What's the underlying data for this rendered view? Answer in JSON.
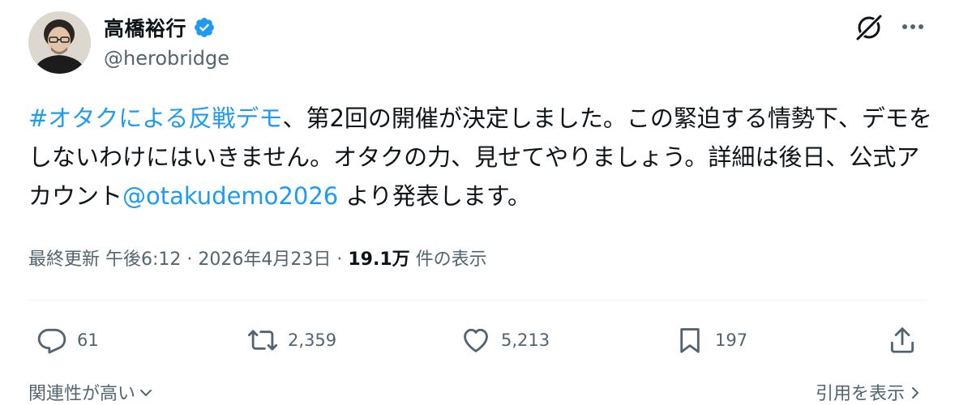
{
  "author": {
    "display_name": "高橋裕行",
    "handle": "@herobridge",
    "verified": true
  },
  "header_icons": {
    "grok": "grok-icon",
    "more": "more-icon"
  },
  "tweet": {
    "hashtag": "#オタクによる反戦デモ",
    "text_part1": "、第2回の開催が決定しました。この緊迫する情勢下、デモをしないわけにはいきません。オタクの力、見せてやりましょう。詳細は後日、公式アカウント",
    "mention": "@otakudemo2026",
    "text_part2": " より発表します。"
  },
  "meta": {
    "updated_label": "最終更新",
    "time": "午後6:12",
    "sep1": " · ",
    "date": "2026年4月23日",
    "sep2": " · ",
    "views_count": "19.1万",
    "views_label": " 件の表示"
  },
  "actions": {
    "reply_count": "61",
    "retweet_count": "2,359",
    "like_count": "5,213",
    "bookmark_count": "197"
  },
  "footer": {
    "related_label": "関連性が高い",
    "quotes_label": "引用を表示"
  },
  "colors": {
    "link": "#1d9bf0",
    "secondary_text": "#536471",
    "primary_text": "#0f1419",
    "divider": "#eff3f4"
  }
}
